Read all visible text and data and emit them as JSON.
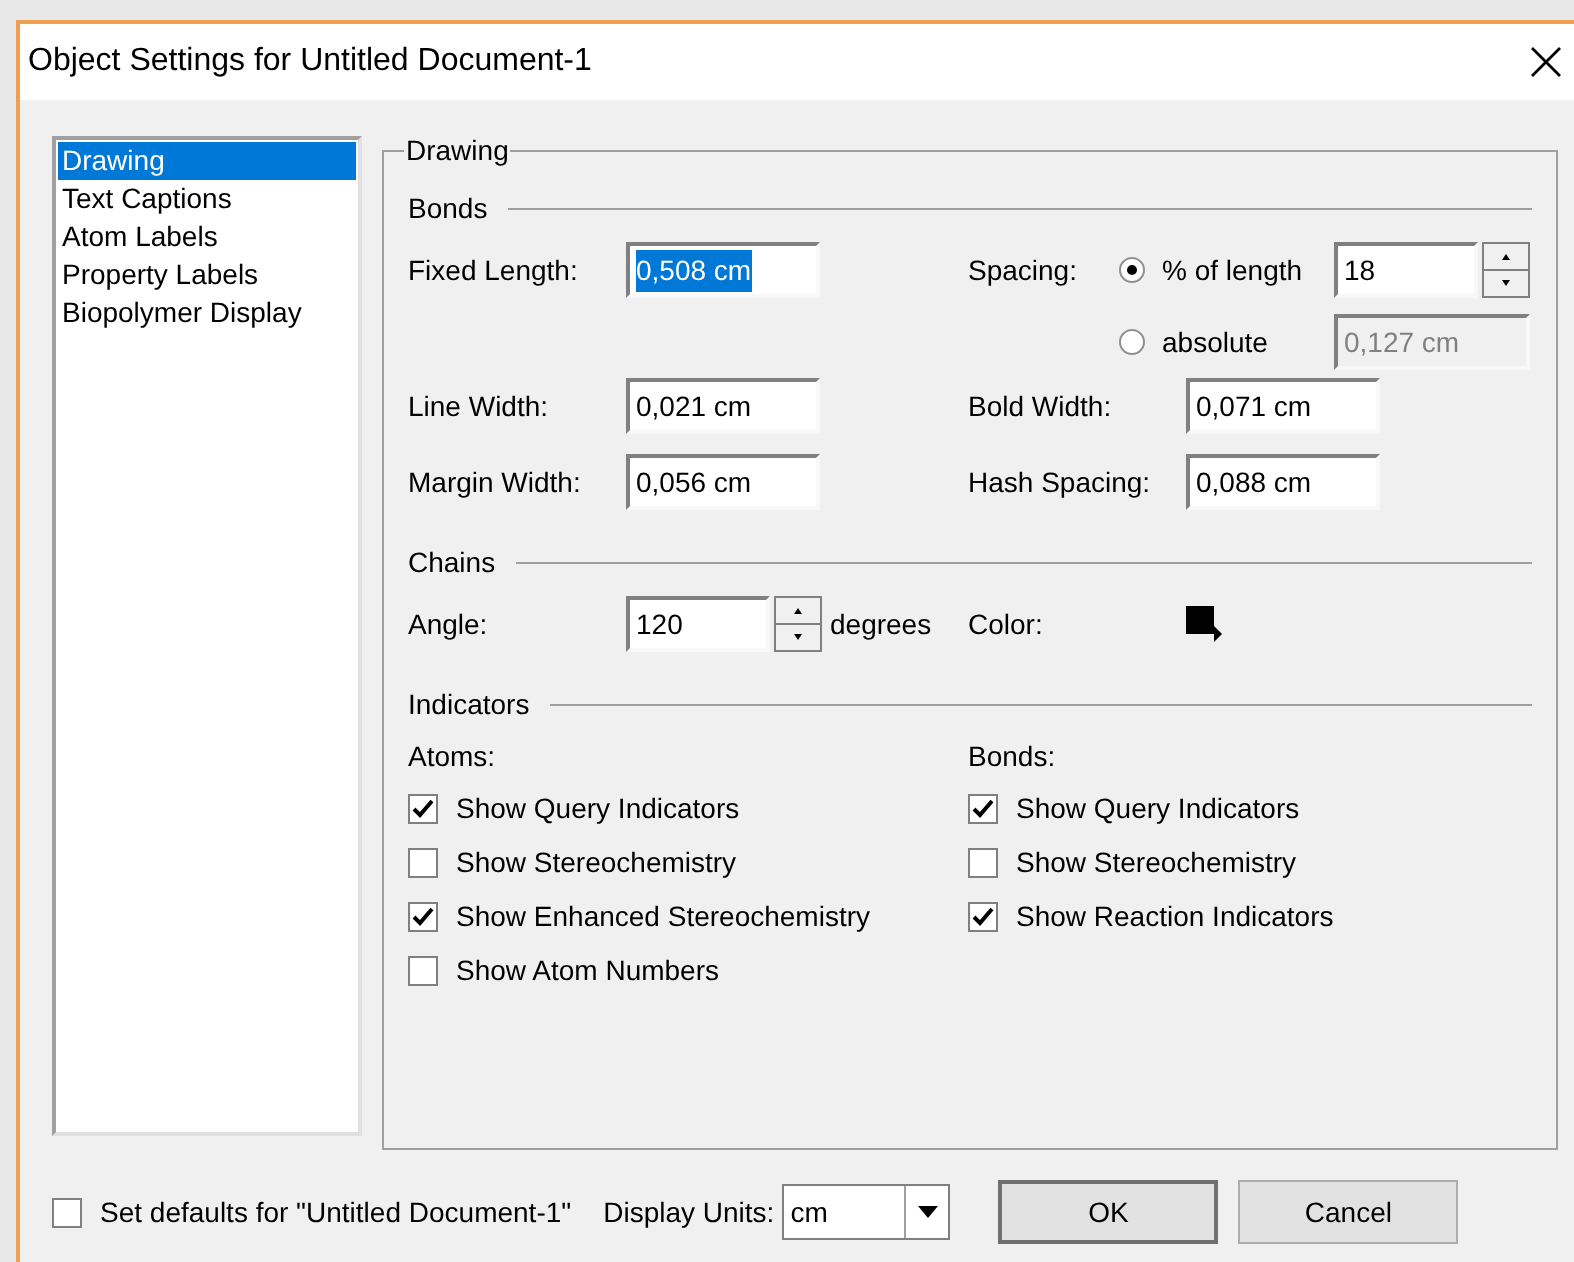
{
  "window": {
    "title": "Object Settings for Untitled Document-1"
  },
  "sidebar": {
    "items": [
      {
        "label": "Drawing",
        "selected": true
      },
      {
        "label": "Text Captions",
        "selected": false
      },
      {
        "label": "Atom Labels",
        "selected": false
      },
      {
        "label": "Property Labels",
        "selected": false
      },
      {
        "label": "Biopolymer Display",
        "selected": false
      }
    ]
  },
  "panel": {
    "title": "Drawing",
    "bonds": {
      "heading": "Bonds",
      "fixed_length": {
        "label": "Fixed Length:",
        "value": "0,508 cm",
        "highlighted": true
      },
      "spacing": {
        "label": "Spacing:",
        "options": [
          {
            "label": "% of length",
            "selected": true,
            "value": "18",
            "disabled": false,
            "kind": "spinner"
          },
          {
            "label": "absolute",
            "selected": false,
            "value": "0,127 cm",
            "disabled": true,
            "kind": "field"
          }
        ]
      },
      "rows": [
        [
          {
            "label": "Line Width:",
            "value": "0,021 cm"
          },
          {
            "label": "Bold Width:",
            "value": "0,071 cm"
          }
        ],
        [
          {
            "label": "Margin Width:",
            "value": "0,056 cm"
          },
          {
            "label": "Hash Spacing:",
            "value": "0,088 cm"
          }
        ]
      ]
    },
    "chains": {
      "heading": "Chains",
      "angle": {
        "label": "Angle:",
        "value": "120",
        "unit": "degrees"
      },
      "color": {
        "label": "Color:",
        "color": "#000000"
      }
    },
    "indicators": {
      "heading": "Indicators",
      "columns": [
        {
          "label": "Atoms:",
          "items": [
            {
              "label": "Show Query Indicators",
              "checked": true
            },
            {
              "label": "Show Stereochemistry",
              "checked": false
            },
            {
              "label": "Show Enhanced Stereochemistry",
              "checked": true
            },
            {
              "label": "Show Atom Numbers",
              "checked": false
            }
          ]
        },
        {
          "label": "Bonds:",
          "items": [
            {
              "label": "Show Query Indicators",
              "checked": true
            },
            {
              "label": "Show Stereochemistry",
              "checked": false
            },
            {
              "label": "Show Reaction Indicators",
              "checked": true
            }
          ]
        }
      ]
    }
  },
  "footer": {
    "defaults": {
      "label": "Set defaults for \"Untitled Document-1\"",
      "checked": false
    },
    "units": {
      "label": "Display Units:",
      "value": "cm"
    },
    "buttons": [
      {
        "label": "OK",
        "default": true
      },
      {
        "label": "Cancel",
        "default": false
      }
    ]
  }
}
